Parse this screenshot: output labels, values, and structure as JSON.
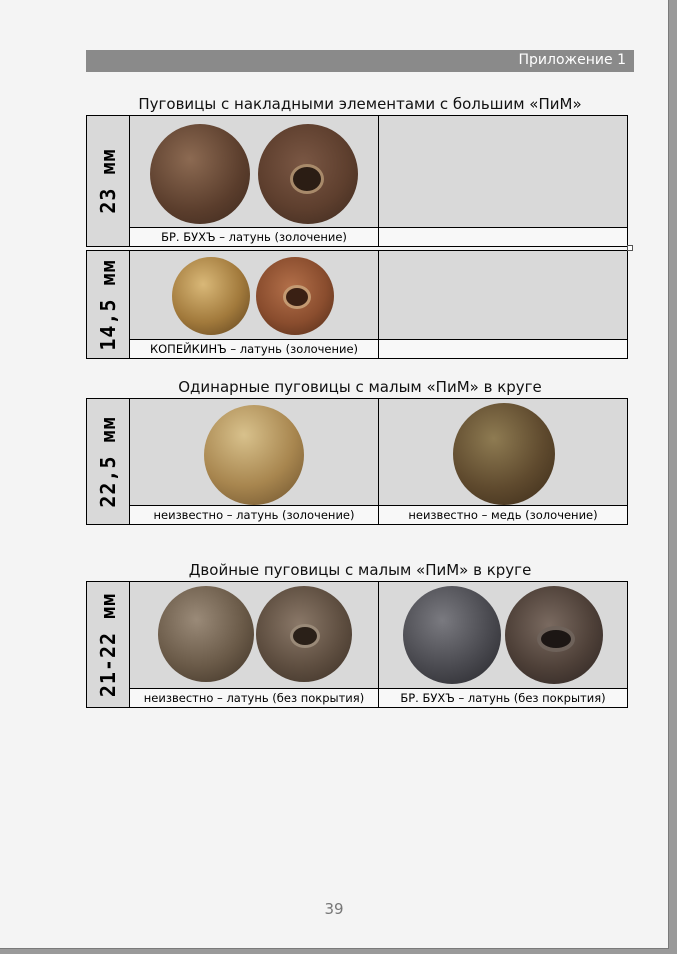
{
  "header": {
    "appendix_label": "Приложение 1"
  },
  "sections": [
    {
      "title": "Пуговицы с накладными элементами с большим «ПиМ»"
    },
    {
      "title": "Одинарные пуговицы с малым «ПиМ» в круге"
    },
    {
      "title": "Двойные пуговицы с малым «ПиМ» в круге"
    }
  ],
  "rows": [
    {
      "size": "23 мм",
      "captions": [
        "БР. БУХЪ – латунь (золочение)",
        ""
      ]
    },
    {
      "size": "14,5 мм",
      "captions": [
        "КОПЕЙКИНЪ – латунь (золочение)",
        ""
      ]
    },
    {
      "size": "22,5 мм",
      "captions": [
        "неизвестно – латунь (золочение)",
        "неизвестно – медь (золочение)"
      ]
    },
    {
      "size": "21-22 мм",
      "captions": [
        "неизвестно – латунь (без покрытия)",
        "БР. БУХЪ – латунь (без покрытия)"
      ]
    }
  ],
  "footer": {
    "page_number": "39"
  }
}
